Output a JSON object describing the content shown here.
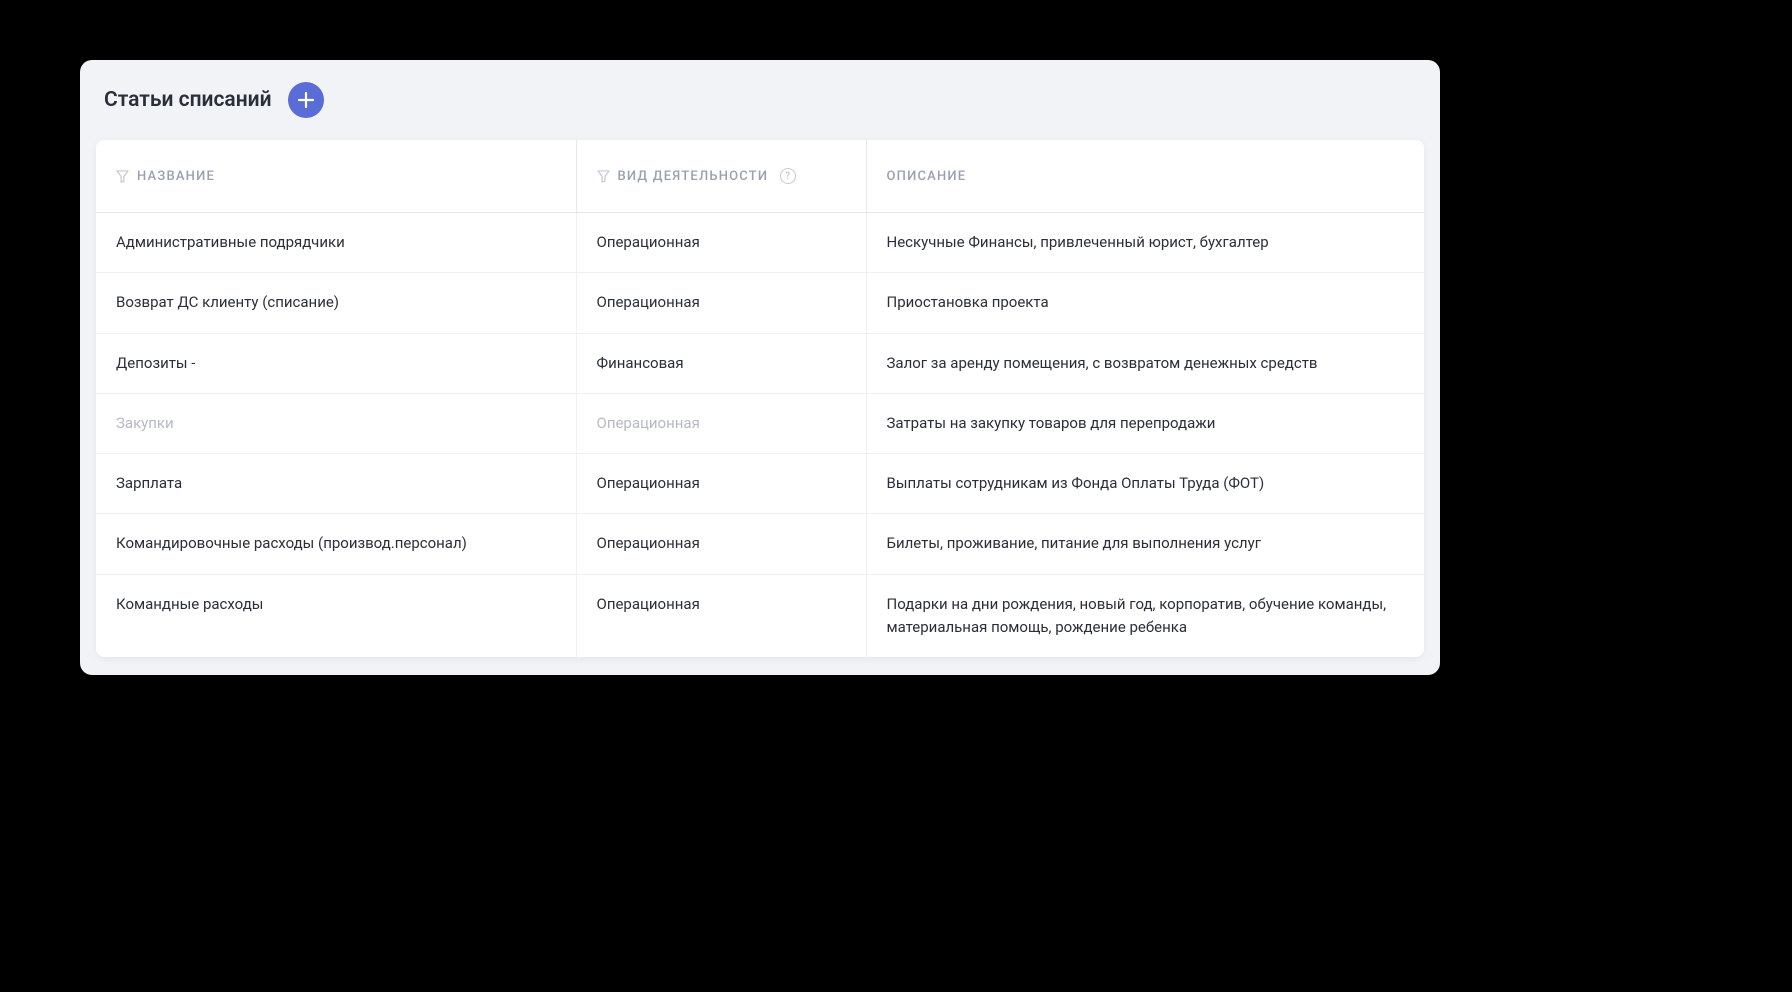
{
  "header": {
    "title": "Статьи списаний"
  },
  "table": {
    "columns": {
      "name": "НАЗВАНИЕ",
      "type": "ВИД ДЕЯТЕЛЬНОСТИ",
      "desc": "ОПИСАНИЕ"
    },
    "rows": [
      {
        "name": "Административные подрядчики",
        "type": "Операционная",
        "desc": "Нескучные Финансы, привлеченный юрист, бухгалтер",
        "muted": false
      },
      {
        "name": "Возврат ДС клиенту (списание)",
        "type": "Операционная",
        "desc": "Приостановка проекта",
        "muted": false
      },
      {
        "name": "Депозиты -",
        "type": "Финансовая",
        "desc": "Залог за аренду помещения, с возвратом денежных средств",
        "muted": false
      },
      {
        "name": "Закупки",
        "type": "Операционная",
        "desc": "Затраты на закупку товаров для перепродажи",
        "muted": true
      },
      {
        "name": "Зарплата",
        "type": "Операционная",
        "desc": "Выплаты сотрудникам из Фонда Оплаты Труда (ФОТ)",
        "muted": false
      },
      {
        "name": "Командировочные расходы (производ.персонал)",
        "type": "Операционная",
        "desc": "Билеты, проживание, питание для выполнения услуг",
        "muted": false
      },
      {
        "name": "Командные расходы",
        "type": "Операционная",
        "desc": "Подарки на дни рождения, новый год, корпоратив, обучение команды, материальная помощь, рождение ребенка",
        "muted": false
      }
    ]
  }
}
